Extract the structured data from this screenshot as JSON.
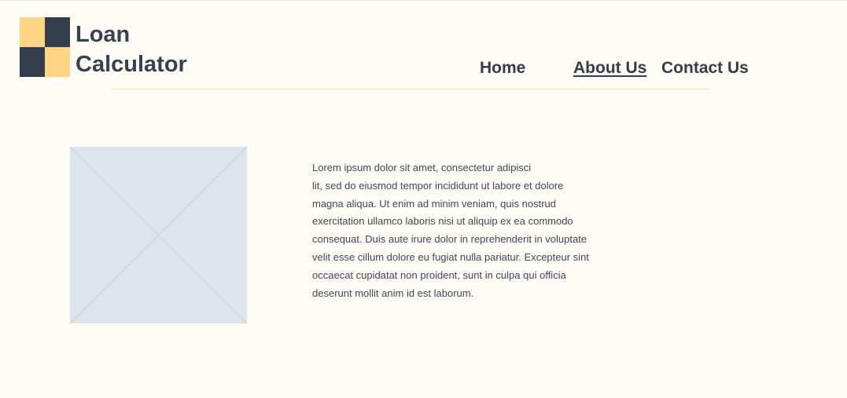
{
  "brand": {
    "line1": "Loan",
    "line2": "Calculator",
    "logo_colors": [
      "#ffd485",
      "#343d4c"
    ]
  },
  "nav": {
    "items": [
      {
        "label": "Home",
        "active": false
      },
      {
        "label": "About Us",
        "active": true
      },
      {
        "label": "Contact Us",
        "active": false
      }
    ]
  },
  "content": {
    "image_placeholder": "image-placeholder-icon",
    "paragraph_lines": [
      "Lorem ipsum dolor sit amet, consectetur adipisci",
      "lit, sed do eiusmod tempor incididunt ut labore et dolore",
      "magna aliqua. Ut enim ad minim veniam, quis nostrud",
      "exercitation ullamco laboris nisi ut aliquip ex ea commodo",
      "consequat. Duis aute irure dolor in reprehenderit in voluptate",
      "velit esse cillum dolore eu fugiat nulla pariatur. Excepteur sint",
      "occaecat cupidatat non proident, sunt in culpa qui officia",
      "deserunt mollit anim id est laborum."
    ]
  },
  "colors": {
    "background": "#fffbf5",
    "text": "#374151",
    "accent": "#ffd485",
    "placeholder": "#dee4ed"
  }
}
